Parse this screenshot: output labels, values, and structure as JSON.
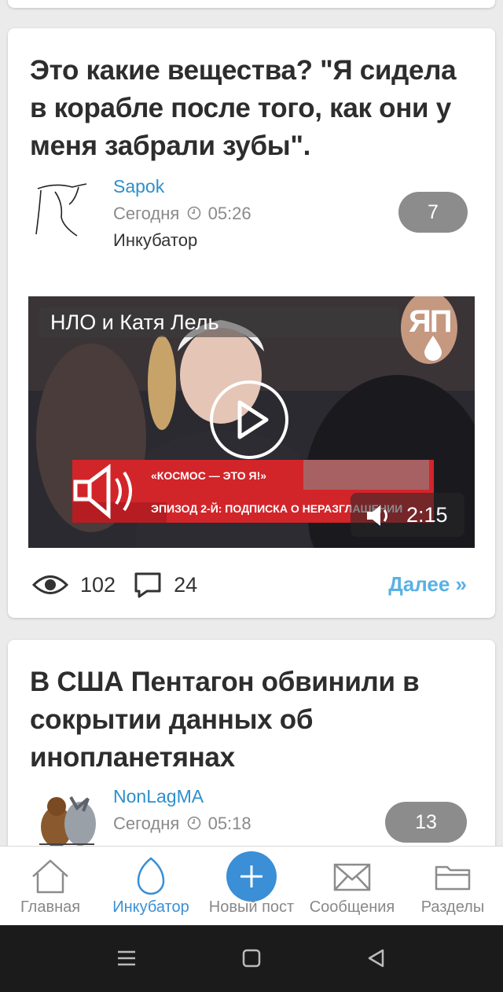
{
  "posts": [
    {
      "title": "Это какие вещества? \"Я сидела в корабле после того, как они у меня забрали зубы\".",
      "author": "Sapok",
      "date": "Сегодня",
      "time": "05:26",
      "section": "Инкубатор",
      "rating": "7",
      "video": {
        "title": "НЛО и Катя Лель",
        "channel_logo": "ЯП",
        "banner_line1": "«КОСМОС — ЭТО Я!»",
        "banner_line2": "ЭПИЗОД 2-Й: ПОДПИСКА О НЕРАЗГЛАШЕНИИ",
        "duration": "2:15"
      },
      "views": "102",
      "comments": "24",
      "more_label": "Далее »"
    },
    {
      "title": "В США Пентагон обвинили в сокрытии данных об инопланетянах",
      "author": "NonLagMA",
      "date": "Сегодня",
      "time": "05:18",
      "rating": "13"
    }
  ],
  "nav": {
    "home": "Главная",
    "incubator": "Инкубатор",
    "new_post": "Новый пост",
    "messages": "Сообщения",
    "sections": "Разделы"
  },
  "colors": {
    "accent": "#3a8fd6",
    "author": "#2d8fcb",
    "badge": "#8c8c8c",
    "more_link": "#5ab1e3",
    "video_banner": "#d2252a"
  },
  "icons": {
    "views": "eye-icon",
    "comments": "comment-icon",
    "time": "clock-icon",
    "home": "home-icon",
    "incubator": "egg-icon",
    "new_post": "plus-icon",
    "messages": "envelope-icon",
    "sections": "folder-icon"
  }
}
